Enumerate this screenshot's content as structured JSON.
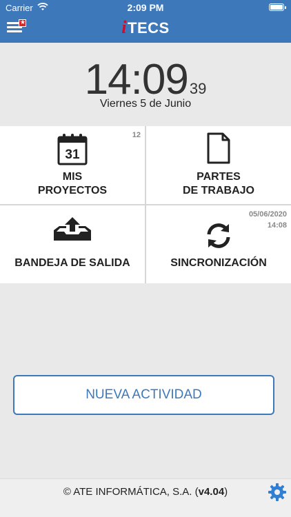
{
  "status_bar": {
    "carrier": "Carrier",
    "time": "2:09 PM"
  },
  "header": {
    "logo_prefix": "i",
    "logo_text": "TECS"
  },
  "clock": {
    "time": "14:09",
    "seconds": "39",
    "date": "Viernes 5 de Junio"
  },
  "tiles": [
    {
      "line1": "MIS",
      "line2": "PROYECTOS",
      "badge": "12",
      "calendar_day": "31",
      "icon": "calendar-icon"
    },
    {
      "line1": "PARTES",
      "line2": "DE TRABAJO",
      "icon": "document-icon"
    },
    {
      "line1": "BANDEJA DE SALIDA",
      "icon": "outbox-upload-icon"
    },
    {
      "line1": "SINCRONIZACIÓN",
      "badge_date": "05/06/2020",
      "badge_time": "14:08",
      "icon": "sync-icon"
    }
  ],
  "new_activity_label": "NUEVA ACTIVIDAD",
  "footer": {
    "company": "© ATE INFORMÁTICA, S.A. (",
    "version": "v4.04",
    "close": ")"
  },
  "colors": {
    "brand_blue": "#3d78ba",
    "accent_red": "#c8102e",
    "background": "#e9e9e9"
  }
}
